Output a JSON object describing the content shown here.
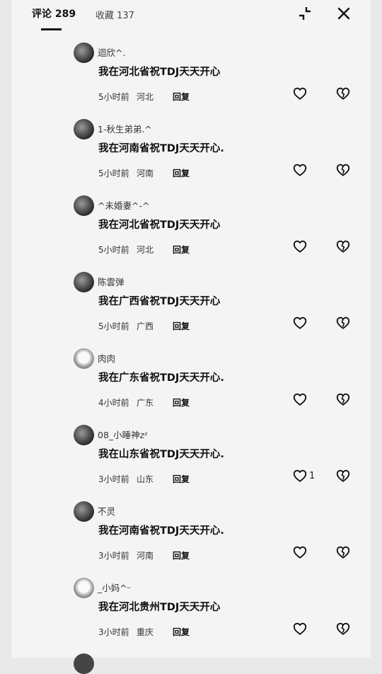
{
  "header": {
    "comments_tab": "评论 289",
    "saved_tab": "收藏 137"
  },
  "comments": [
    {
      "username": "迴欣^.",
      "text": "我在河北省祝TDJ天天开心",
      "time": "5小时前",
      "location": "河北",
      "reply": "回复",
      "likes": ""
    },
    {
      "username": "1-秋生弟弟.^",
      "text": "我在河南省祝TDJ天天开心.",
      "time": "5小时前",
      "location": "河南",
      "reply": "回复",
      "likes": ""
    },
    {
      "username": "^未婚妻^-^",
      "text": "我在河北省祝TDJ天天开心",
      "time": "5小时前",
      "location": "河北",
      "reply": "回复",
      "likes": ""
    },
    {
      "username": "陈雲弹",
      "text": "我在广西省祝TDJ天天开心",
      "time": "5小时前",
      "location": "广西",
      "reply": "回复",
      "likes": ""
    },
    {
      "username": "肉肉",
      "text": "我在广东省祝TDJ天天开心.",
      "time": "4小时前",
      "location": "广东",
      "reply": "回复",
      "likes": ""
    },
    {
      "username": "08_小睡神zᶻ",
      "text": "我在山东省祝TDJ天天开心.",
      "time": "3小时前",
      "location": "山东",
      "reply": "回复",
      "likes": "1"
    },
    {
      "username": "不灵",
      "text": "我在河南省祝TDJ天天开心.",
      "time": "3小时前",
      "location": "河南",
      "reply": "回复",
      "likes": ""
    },
    {
      "username": "_小妈^ᵕ",
      "text": "我在河北贵州TDJ天天开心",
      "time": "3小时前",
      "location": "重庆",
      "reply": "回复",
      "likes": ""
    }
  ]
}
